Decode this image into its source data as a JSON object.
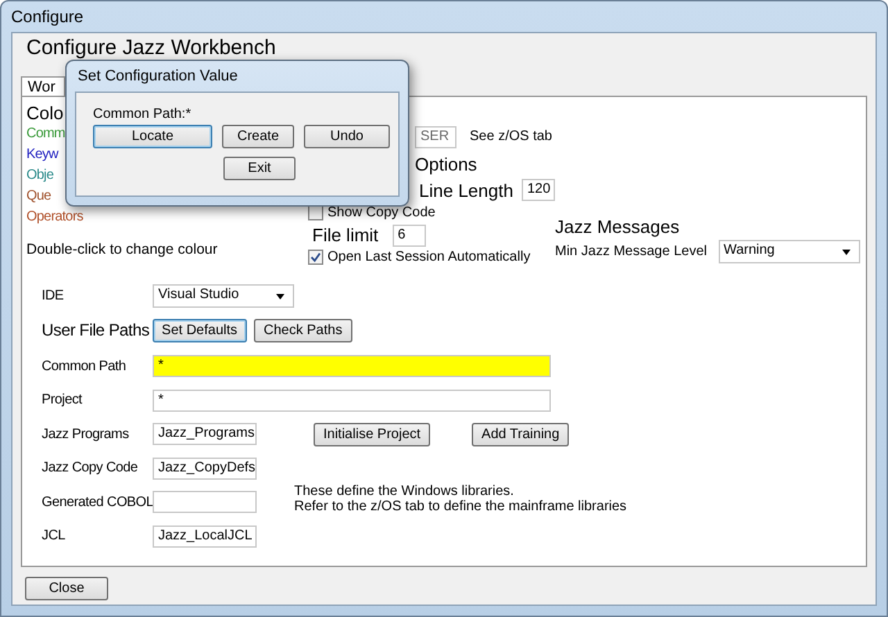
{
  "window": {
    "title": "Configure"
  },
  "heading": "Configure Jazz Workbench",
  "tabs": [
    {
      "label": "Wor",
      "selected": true
    }
  ],
  "colours": {
    "heading": "Colo",
    "items": [
      {
        "label": "Comm",
        "color": "#3a9a3a"
      },
      {
        "label": "Keyw",
        "color": "#2020c0"
      },
      {
        "label": "Obje",
        "color": "#2a8a8a"
      },
      {
        "label": "Que",
        "color": "#a0522d"
      },
      {
        "label": "Operators",
        "color": "#b0502a"
      }
    ],
    "hint": "Double-click to change colour"
  },
  "user_field": {
    "value": "SER",
    "disabled": true,
    "note": "See z/OS tab"
  },
  "options": {
    "heading": "Options",
    "line_length_label": "Line Length",
    "line_length": "120",
    "show_copy_code": {
      "label": "Show Copy Code",
      "checked": false
    },
    "file_limit_label": "File limit",
    "file_limit": "6",
    "open_last_session": {
      "label": "Open Last Session Automatically",
      "checked": true
    }
  },
  "jazz_messages": {
    "heading": "Jazz Messages",
    "label": "Min Jazz Message Level",
    "value": "Warning"
  },
  "ide": {
    "label": "IDE",
    "value": "Visual Studio"
  },
  "user_file_paths": {
    "heading": "User File Paths",
    "buttons": [
      {
        "label": "Set Defaults",
        "focused": true
      },
      {
        "label": "Check Paths",
        "focused": false
      }
    ]
  },
  "paths": [
    {
      "label": "Common Path",
      "value": "*",
      "kind": "wide",
      "highlighted": true
    },
    {
      "label": "Project",
      "value": "*",
      "kind": "wide",
      "highlighted": false
    },
    {
      "label": "Jazz Programs",
      "value": "Jazz_Programs",
      "kind": "short",
      "highlighted": false,
      "buttons": [
        "Initialise Project",
        "Add Training"
      ]
    },
    {
      "label": "Jazz Copy Code",
      "value": "Jazz_CopyDefs",
      "kind": "short",
      "highlighted": false
    },
    {
      "label": "Generated COBOL",
      "kind": "short",
      "highlighted": false,
      "note": [
        "These define the Windows libraries.",
        "Refer to the z/OS tab to define the mainframe libraries"
      ]
    },
    {
      "label": "JCL",
      "value": "Jazz_LocalJCL",
      "kind": "short",
      "highlighted": false
    }
  ],
  "close_button": "Close",
  "dialog": {
    "title": "Set Configuration Value",
    "prompt": "Common Path:*",
    "buttons": [
      {
        "label": "Locate",
        "focused": true
      },
      {
        "label": "Create",
        "focused": false
      },
      {
        "label": "Undo",
        "focused": false
      }
    ],
    "exit_button": "Exit"
  }
}
